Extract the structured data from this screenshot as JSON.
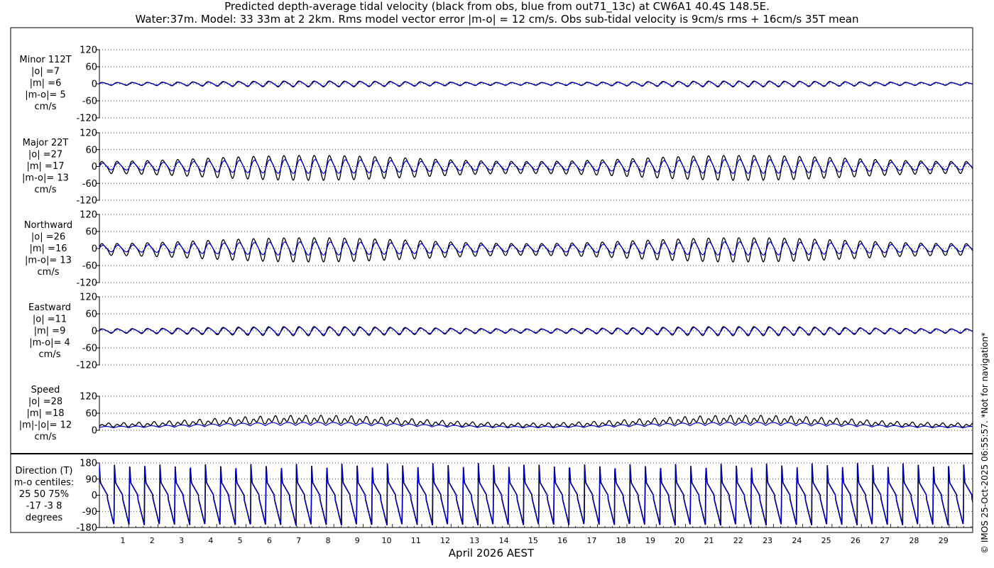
{
  "header": {
    "title_line1": "Predicted depth-average tidal velocity (black from obs, blue from out71_13c) at CW6A1 40.4S 148.5E.",
    "title_line2": "Water:37m. Model: 33 33m at 2 2km. Rms model vector error |m-o| = 12 cm/s. Obs sub-tidal velocity is 9cm/s rms + 16cm/s 35T mean"
  },
  "footer": {
    "xlabel": "April 2026 AEST",
    "copyright": "© IMOS 25-Oct-2025 06:55:57. *Not for navigation*"
  },
  "colors": {
    "obs": "#000000",
    "model": "#0000cc"
  },
  "chart_data": [
    {
      "type": "line",
      "panel": "minor",
      "labels": [
        "Minor 112T",
        "|o| =7",
        "|m| =6",
        "|m-o|= 5",
        "cm/s"
      ],
      "yticks": [
        "120",
        "60",
        "0",
        "-60",
        "-120"
      ],
      "ylim": [
        -120,
        120
      ],
      "series": [
        {
          "role": "obs",
          "amplitude": 7,
          "offset": 0
        },
        {
          "role": "model",
          "amplitude": 6,
          "offset": 0
        }
      ]
    },
    {
      "type": "line",
      "panel": "major",
      "labels": [
        "Major 22T",
        "|o| =27",
        "|m| =17",
        "|m-o|= 13",
        "cm/s"
      ],
      "yticks": [
        "120",
        "60",
        "0",
        "-60",
        "-120"
      ],
      "ylim": [
        -120,
        120
      ],
      "series": [
        {
          "role": "obs",
          "amplitude": 30,
          "offset": -2
        },
        {
          "role": "model",
          "amplitude": 18,
          "offset": 0
        }
      ]
    },
    {
      "type": "line",
      "panel": "northward",
      "labels": [
        "Northward",
        "|o| =26",
        "|m| =16",
        "|m-o|= 13",
        "cm/s"
      ],
      "yticks": [
        "120",
        "60",
        "0",
        "-60",
        "-120"
      ],
      "ylim": [
        -120,
        120
      ],
      "series": [
        {
          "role": "obs",
          "amplitude": 29,
          "offset": -2
        },
        {
          "role": "model",
          "amplitude": 17,
          "offset": 0
        }
      ]
    },
    {
      "type": "line",
      "panel": "eastward",
      "labels": [
        "Eastward",
        "|o| =11",
        "|m| =9",
        "|m-o|= 4",
        "cm/s"
      ],
      "yticks": [
        "120",
        "60",
        "0",
        "-60",
        "-120"
      ],
      "ylim": [
        -120,
        120
      ],
      "series": [
        {
          "role": "obs",
          "amplitude": 11,
          "offset": 0
        },
        {
          "role": "model",
          "amplitude": 9,
          "offset": 0
        }
      ]
    },
    {
      "type": "line",
      "panel": "speed",
      "labels": [
        "Speed",
        "|o| =28",
        "|m| =18",
        "|m|-|o|= 12",
        "cm/s"
      ],
      "yticks": [
        "120",
        "60",
        "0"
      ],
      "ylim": [
        0,
        120
      ],
      "series": [
        {
          "role": "obs",
          "amplitude": 28,
          "offset": 0
        },
        {
          "role": "model",
          "amplitude": 18,
          "offset": 0
        }
      ]
    },
    {
      "type": "line",
      "panel": "direction",
      "labels": [
        "Direction (T)",
        "m-o centiles:",
        "25  50  75%",
        "-17  -3   8",
        "degrees"
      ],
      "yticks": [
        "180",
        "90",
        "0",
        "-90",
        "-180"
      ],
      "ylim": [
        -180,
        180
      ],
      "series": [
        {
          "role": "obs",
          "amplitude": 180,
          "offset": 0
        },
        {
          "role": "model",
          "amplitude": 180,
          "offset": 0
        }
      ]
    }
  ],
  "x_axis": {
    "ticks": [
      "1",
      "2",
      "3",
      "4",
      "5",
      "6",
      "7",
      "8",
      "9",
      "10",
      "11",
      "12",
      "13",
      "14",
      "15",
      "16",
      "17",
      "18",
      "19",
      "20",
      "21",
      "22",
      "23",
      "24",
      "25",
      "26",
      "27",
      "28",
      "29"
    ],
    "range_days": [
      0,
      29.8
    ],
    "cycles_per_day": 1.9323
  }
}
